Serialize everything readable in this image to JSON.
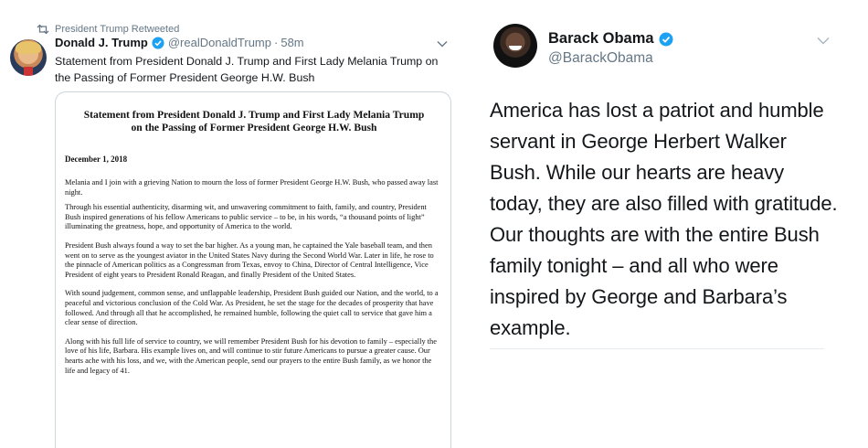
{
  "colors": {
    "twitter_blue": "#1da1f2",
    "secondary_text": "#657786",
    "text": "#14171a",
    "border": "#ccd6dd"
  },
  "left_tweet": {
    "retweet_label": "President Trump Retweeted",
    "retweet_icon": "retweet-icon",
    "author_name": "Donald J. Trump",
    "verified_icon": "verified-badge-icon",
    "handle": "@realDonaldTrump",
    "separator": "·",
    "time": "58m",
    "menu_icon": "chevron-down-icon",
    "text": "Statement from President Donald J. Trump and First Lady Melania Trump on the Passing of Former President George H.W. Bush",
    "statement": {
      "title": "Statement from President Donald J. Trump and First Lady Melania Trump on the Passing of Former President George H.W. Bush",
      "date": "December 1, 2018",
      "paragraphs": [
        "Melania and I join with a grieving Nation to mourn the loss of former President George H.W. Bush, who passed away last night.",
        "Through his essential authenticity, disarming wit, and unwavering commitment to faith, family, and country, President Bush inspired generations of his fellow Americans to public service – to be, in his words, “a thousand points of light” illuminating the greatness, hope, and opportunity of America to the world.",
        "President Bush always found a way to set the bar higher.  As a young man, he captained the Yale baseball team, and then went on to serve as the youngest aviator in the United States Navy during the Second World War.  Later in life, he rose to the pinnacle of American politics as a Congressman from Texas, envoy to China, Director of Central Intelligence, Vice President of eight years to President Ronald Reagan, and finally President of the United States.",
        "With sound judgement, common sense, and unflappable leadership, President Bush guided our Nation, and the world, to a peaceful and victorious conclusion of the Cold War.  As President, he set the stage for the decades of prosperity that have followed.  And through all that he accomplished, he remained humble, following the quiet call to service that gave him a clear sense of direction.",
        "Along with his full life of service to country, we will remember President Bush for his devotion to family – especially the love of his life, Barbara.  His example lives on, and will continue to stir future Americans to pursue a greater cause.  Our hearts ache with his loss, and we, with the American people, send our prayers to the entire Bush family, as we honor the life and legacy of 41."
      ]
    }
  },
  "right_tweet": {
    "author_name": "Barack Obama",
    "verified_icon": "verified-badge-icon",
    "handle": "@BarackObama",
    "menu_icon": "chevron-down-icon",
    "text": "America has lost a patriot and humble servant in George Herbert Walker Bush. While our hearts are heavy today, they are also filled with gratitude. Our thoughts are with the entire Bush family tonight – and all who were inspired by George and Barbara’s example."
  }
}
